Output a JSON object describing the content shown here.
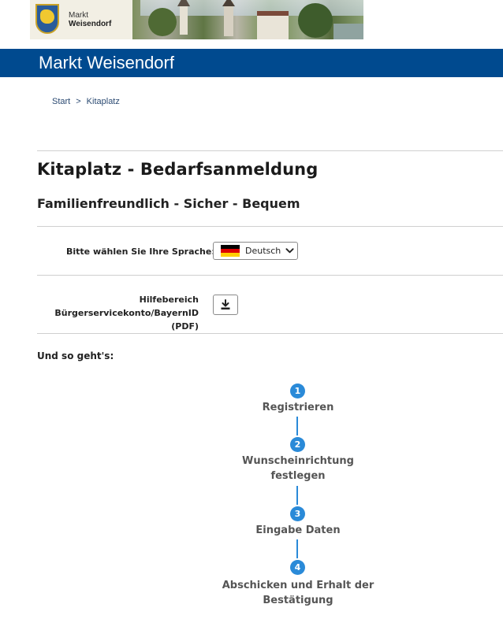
{
  "header": {
    "logo_line1": "Markt",
    "logo_line2": "Weisendorf",
    "site_name": "Markt Weisendorf",
    "brand_color": "#004a8f"
  },
  "breadcrumb": {
    "items": [
      "Start",
      "Kitaplatz"
    ],
    "separator": ">"
  },
  "page": {
    "title": "Kitaplatz - Bedarfsanmeldung",
    "subtitle": "Familienfreundlich - Sicher - Bequem"
  },
  "language": {
    "label": "Bitte wählen Sie Ihre Sprache:",
    "selected": "Deutsch",
    "flag_icon": "germany-flag-icon"
  },
  "help": {
    "label_line1": "Hilfebereich",
    "label_line2": "Bürgerservicekonto/BayernID (PDF)",
    "button_icon": "download-icon"
  },
  "steps": {
    "intro": "Und so geht's:",
    "accent_color": "#2a8ad8",
    "items": [
      {
        "number": "1",
        "label_line1": "Registrieren",
        "label_line2": ""
      },
      {
        "number": "2",
        "label_line1": "Wunscheinrichtung",
        "label_line2": "festlegen"
      },
      {
        "number": "3",
        "label_line1": "Eingabe Daten",
        "label_line2": ""
      },
      {
        "number": "4",
        "label_line1": "Abschicken und Erhalt der",
        "label_line2": "Bestätigung"
      }
    ]
  }
}
